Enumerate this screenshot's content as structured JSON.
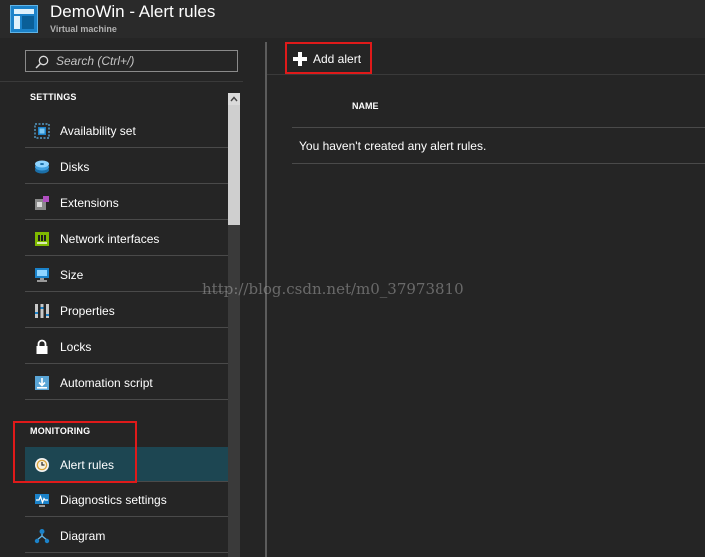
{
  "header": {
    "title": "DemoWin - Alert rules",
    "subtitle": "Virtual machine",
    "icon": "virtual-machine-icon"
  },
  "search": {
    "placeholder": "Search (Ctrl+/)",
    "value": ""
  },
  "sections": {
    "settings": {
      "label": "SETTINGS",
      "items": [
        {
          "label": "Availability set",
          "icon": "availability-set-icon"
        },
        {
          "label": "Disks",
          "icon": "disks-icon"
        },
        {
          "label": "Extensions",
          "icon": "extensions-icon"
        },
        {
          "label": "Network interfaces",
          "icon": "network-interfaces-icon"
        },
        {
          "label": "Size",
          "icon": "size-icon"
        },
        {
          "label": "Properties",
          "icon": "properties-icon"
        },
        {
          "label": "Locks",
          "icon": "lock-icon"
        },
        {
          "label": "Automation script",
          "icon": "automation-script-icon"
        }
      ]
    },
    "monitoring": {
      "label": "MONITORING",
      "items": [
        {
          "label": "Alert rules",
          "icon": "alert-rules-icon",
          "selected": true
        },
        {
          "label": "Diagnostics settings",
          "icon": "diagnostics-icon"
        },
        {
          "label": "Diagram",
          "icon": "diagram-icon"
        }
      ]
    }
  },
  "toolbar": {
    "add_alert_label": "Add alert"
  },
  "table": {
    "column_name": "NAME",
    "empty_message": "You haven't created any alert rules."
  },
  "watermark": "http://blog.csdn.net/m0_37973810",
  "colors": {
    "selected_bg": "#1d4652",
    "highlight": "#e01a1a",
    "accent": "#1b82c9"
  }
}
